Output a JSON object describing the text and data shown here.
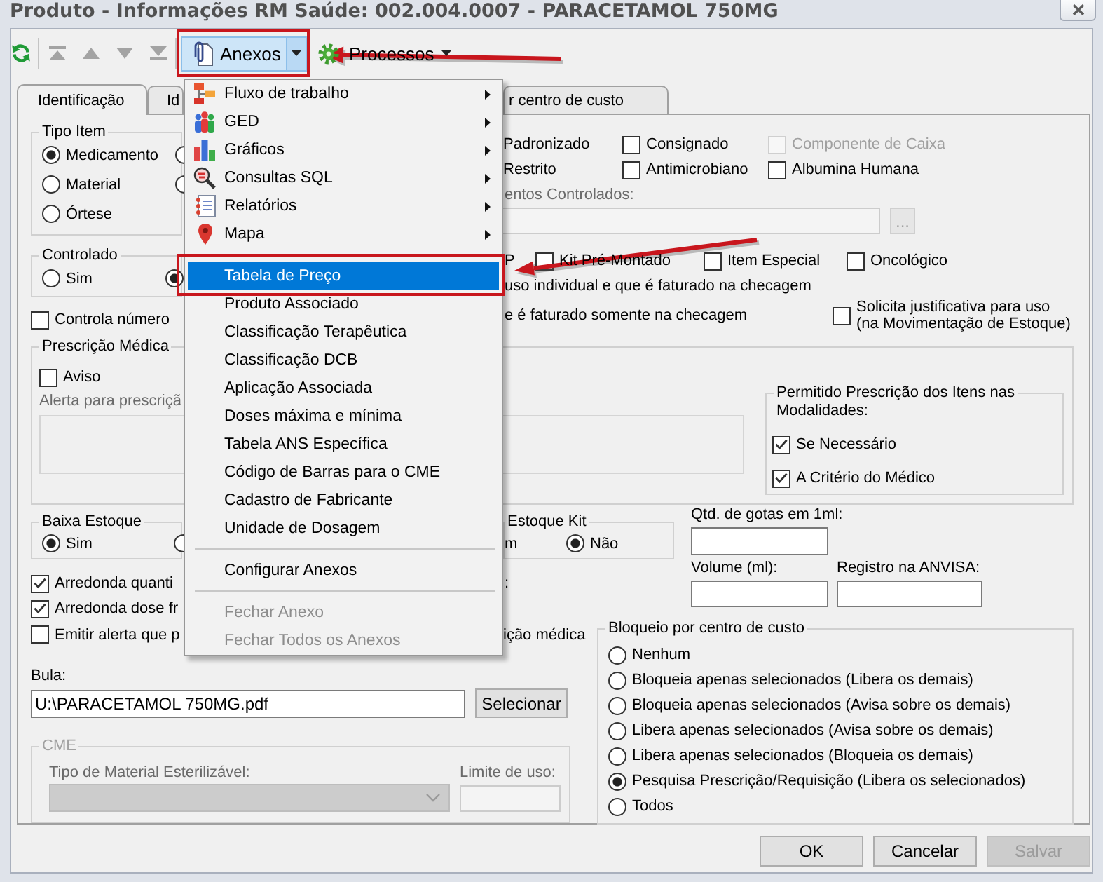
{
  "window": {
    "title": "Produto - Informações RM Saúde: 002.004.0007 - PARACETAMOL 750MG"
  },
  "toolbar": {
    "icon_buttons": [
      {
        "disabled": false
      },
      {
        "disabled": true
      },
      {
        "disabled": true
      },
      {
        "disabled": true
      },
      {
        "disabled": true
      }
    ],
    "menu_buttons": [
      {
        "label": "Anexos",
        "open": true,
        "callout": true
      },
      {
        "label": "Processos",
        "open": false,
        "callout": false
      }
    ]
  },
  "tabs": [
    {
      "label": "Identificação",
      "selected": true
    },
    {
      "label": "Id",
      "selected": false
    },
    {
      "label": "r centro de custo",
      "selected": false
    }
  ],
  "tipo_item": {
    "legend": "Tipo Item",
    "options": [
      {
        "label": "Medicamento",
        "selected": true
      },
      {
        "selected": false
      },
      {
        "label": "Material",
        "selected": false
      },
      {
        "selected": false
      },
      {
        "label": "Órtese",
        "selected": false
      }
    ]
  },
  "atributos": [
    {
      "label": "Padronizado",
      "disabled": false
    },
    {
      "label": "Consignado",
      "checked": false,
      "disabled": false
    },
    {
      "label": "Componente de Caixa",
      "checked": false,
      "disabled": true
    },
    {
      "label": "Restrito",
      "disabled": false
    },
    {
      "label": "Antimicrobiano",
      "checked": false,
      "disabled": false
    },
    {
      "label": "Albumina Humana",
      "checked": false,
      "disabled": false
    }
  ],
  "controlados": {
    "label": "entos Controlados:",
    "button": "...",
    "disabled": true
  },
  "controlado": {
    "legend": "Controlado",
    "options": [
      {
        "label": "Sim",
        "selected": false
      },
      {
        "selected": true
      }
    ]
  },
  "controla_numero": {
    "label": "Controla número",
    "checked": false
  },
  "caracteristicas": {
    "fragment": "P",
    "items": [
      {
        "label": "Kit Pré-Montado",
        "checked": false
      },
      {
        "label": "Item Especial",
        "checked": false
      },
      {
        "label": "Oncológico",
        "checked": false
      }
    ]
  },
  "label_fragments": [
    "uso individual e que é faturado na checagem",
    "e é faturado somente na checagem"
  ],
  "solicita_justificativa": {
    "label": "Solicita justificativa para uso\n(na Movimentação de Estoque)",
    "checked": false
  },
  "prescricao_medica": {
    "legend": "Prescrição Médica",
    "aviso": {
      "label": "Aviso",
      "checked": false
    },
    "alerta": {
      "label": "Alerta para prescriçã",
      "disabled": true
    },
    "modalidades": {
      "legend": "Permitido Prescrição dos Itens nas\nModalidades:",
      "options": [
        {
          "label": "Se Necessário",
          "checked": true
        },
        {
          "label": "A Critério do Médico",
          "checked": true
        }
      ]
    }
  },
  "baixa_estoque": {
    "legend": "Baixa Estoque",
    "options": [
      {
        "label": "Sim",
        "selected": true
      },
      {
        "selected": false
      }
    ]
  },
  "estoque_kit": {
    "legend": "Estoque Kit",
    "options": [
      {
        "label": "m"
      },
      {
        "label": "Não",
        "selected": true
      }
    ]
  },
  "arredondamento": [
    {
      "label": "Arredonda quanti",
      "label_end": ":",
      "checked": true
    },
    {
      "label": "Arredonda dose fr",
      "checked": true
    },
    {
      "label": "Emitir alerta que p",
      "label_end": "ição médica",
      "checked": false
    }
  ],
  "medidas": [
    {
      "label": "Qtd. de gotas em 1ml:"
    },
    {
      "label": "Volume (ml):"
    },
    {
      "label": "Registro na ANVISA:"
    }
  ],
  "bula": {
    "label": "Bula:",
    "value": "U:\\PARACETAMOL 750MG.pdf",
    "button": "Selecionar"
  },
  "cme": {
    "legend": "CME",
    "disabled": true,
    "tipo_label": "Tipo de Material Esterilizável:",
    "limite_label": "Limite de uso:"
  },
  "bloqueio": {
    "legend": "Bloqueio por centro de custo",
    "options": [
      {
        "label": "Nenhum",
        "selected": false
      },
      {
        "label": "Bloqueia apenas selecionados (Libera os demais)",
        "selected": false
      },
      {
        "label": "Bloqueia apenas selecionados (Avisa sobre os demais)",
        "selected": false
      },
      {
        "label": "Libera apenas selecionados (Avisa sobre os demais)",
        "selected": false
      },
      {
        "label": "Libera apenas selecionados (Bloqueia os demais)",
        "selected": false
      },
      {
        "label": "Pesquisa Prescrição/Requisição (Libera os selecionados)",
        "selected": true
      },
      {
        "label": "Todos",
        "selected": false
      }
    ]
  },
  "menu": {
    "items": [
      {
        "label": "Fluxo de trabalho",
        "kind": "submenu",
        "selected": false,
        "disabled": false,
        "callout": false
      },
      {
        "label": "GED",
        "kind": "submenu",
        "selected": false,
        "disabled": false,
        "callout": false
      },
      {
        "label": "Gráficos",
        "kind": "submenu",
        "selected": false,
        "disabled": false,
        "callout": false
      },
      {
        "label": "Consultas SQL",
        "kind": "submenu",
        "selected": false,
        "disabled": false,
        "callout": false
      },
      {
        "label": "Relatórios",
        "kind": "submenu",
        "selected": false,
        "disabled": false,
        "callout": false
      },
      {
        "label": "Mapa",
        "kind": "submenu",
        "selected": false,
        "disabled": false,
        "callout": false
      },
      {
        "kind": "separator"
      },
      {
        "label": "Tabela de Preço",
        "kind": "action",
        "selected": true,
        "disabled": false,
        "callout": true
      },
      {
        "label": "Produto Associado",
        "kind": "action",
        "selected": false,
        "disabled": false,
        "callout": false
      },
      {
        "label": "Classificação Terapêutica",
        "kind": "action",
        "selected": false,
        "disabled": false,
        "callout": false
      },
      {
        "label": "Classificação DCB",
        "kind": "action",
        "selected": false,
        "disabled": false,
        "callout": false
      },
      {
        "label": "Aplicação Associada",
        "kind": "action",
        "selected": false,
        "disabled": false,
        "callout": false
      },
      {
        "label": "Doses máxima e mínima",
        "kind": "action",
        "selected": false,
        "disabled": false,
        "callout": false
      },
      {
        "label": "Tabela ANS Específica",
        "kind": "action",
        "selected": false,
        "disabled": false,
        "callout": false
      },
      {
        "label": "Código de Barras para o CME",
        "kind": "action",
        "selected": false,
        "disabled": false,
        "callout": false
      },
      {
        "label": "Cadastro de Fabricante",
        "kind": "action",
        "selected": false,
        "disabled": false,
        "callout": false
      },
      {
        "label": "Unidade de Dosagem",
        "kind": "action",
        "selected": false,
        "disabled": false,
        "callout": false
      },
      {
        "kind": "separator"
      },
      {
        "label": "Configurar Anexos",
        "kind": "action",
        "selected": false,
        "disabled": false,
        "callout": false
      },
      {
        "kind": "separator"
      },
      {
        "label": "Fechar Anexo",
        "kind": "action",
        "selected": false,
        "disabled": true,
        "callout": false
      },
      {
        "label": "Fechar Todos os Anexos",
        "kind": "action",
        "selected": false,
        "disabled": true,
        "callout": false
      }
    ]
  },
  "buttons": [
    {
      "label": "OK",
      "disabled": false
    },
    {
      "label": "Cancelar",
      "disabled": false
    },
    {
      "label": "Salvar",
      "disabled": true
    }
  ]
}
